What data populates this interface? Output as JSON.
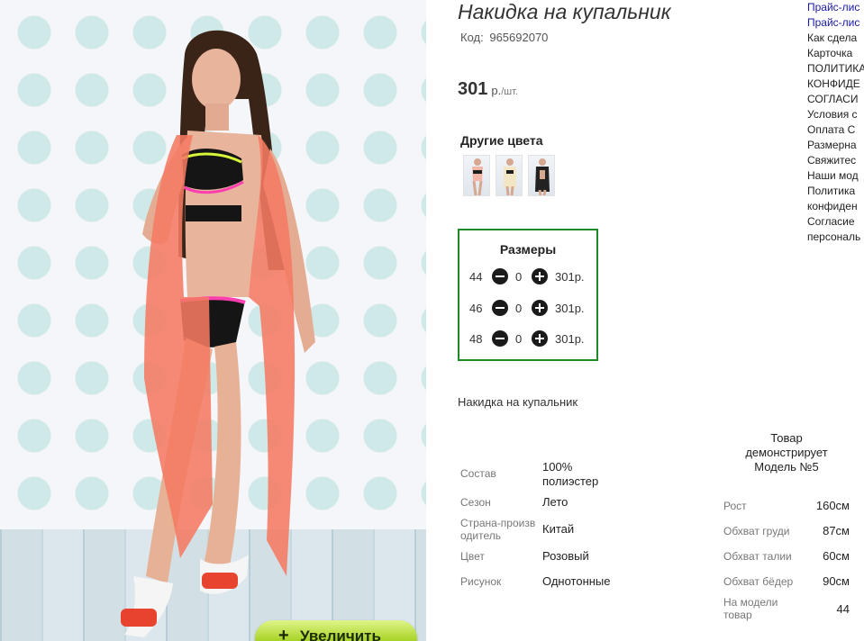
{
  "product": {
    "title": "Накидка на купальник",
    "code_label": "Код:",
    "code_value": "965692070",
    "price": "301",
    "price_unit": "р.",
    "price_per": "/шт."
  },
  "photo": {
    "zoom_label": "Увеличить",
    "zoom_plus": "+"
  },
  "other_colors": {
    "title": "Другие цвета",
    "thumbs": [
      "thumb-1",
      "thumb-2",
      "thumb-3"
    ]
  },
  "sizes": {
    "title": "Размеры",
    "rows": [
      {
        "size": "44",
        "qty": "0",
        "price": "301р."
      },
      {
        "size": "46",
        "qty": "0",
        "price": "301р."
      },
      {
        "size": "48",
        "qty": "0",
        "price": "301р."
      }
    ]
  },
  "description": "Накидка на купальник",
  "attributes": [
    {
      "label": "Состав",
      "value": "100% полиэстер"
    },
    {
      "label": "Сезон",
      "value": "Лето"
    },
    {
      "label": "Страна-производитель",
      "value": "Китай"
    },
    {
      "label": "Цвет",
      "value": "Розовый"
    },
    {
      "label": "Рисунок",
      "value": "Однотонные"
    }
  ],
  "model_info": {
    "header": "Товар демонстрирует Модель №5",
    "rows": [
      {
        "label": "Рост",
        "value": "160см"
      },
      {
        "label": "Обхват груди",
        "value": "87см"
      },
      {
        "label": "Обхват талии",
        "value": "60см"
      },
      {
        "label": "Обхват бёдер",
        "value": "90см"
      },
      {
        "label": "На модели товар",
        "value": "44"
      }
    ]
  },
  "right_links": [
    {
      "text": "Прайс-лис",
      "style": "blue"
    },
    {
      "text": "Прайс-лис",
      "style": "blue"
    },
    {
      "text": "Как сдела",
      "style": "dark"
    },
    {
      "text": "Карточка",
      "style": "dark"
    },
    {
      "text": "ПОЛИТИКА",
      "style": "dark"
    },
    {
      "text": "КОНФИДЕ",
      "style": "dark"
    },
    {
      "text": "СОГЛАСИ",
      "style": "dark"
    },
    {
      "text": "Условия с",
      "style": "dark"
    },
    {
      "text": "Оплата С",
      "style": "dark"
    },
    {
      "text": "Размерна",
      "style": "dark"
    },
    {
      "text": "Свяжитес",
      "style": "dark"
    },
    {
      "text": "Наши мод",
      "style": "dark"
    },
    {
      "text": "Политика",
      "style": "dark"
    },
    {
      "text": "конфиден",
      "style": "dark"
    },
    {
      "text": "Согласие",
      "style": "dark"
    },
    {
      "text": "персональ",
      "style": "dark"
    }
  ],
  "colors": {
    "accent_green": "#1e8a26",
    "cover_coral": "#f57a62",
    "link_blue": "#1a1aa6"
  }
}
